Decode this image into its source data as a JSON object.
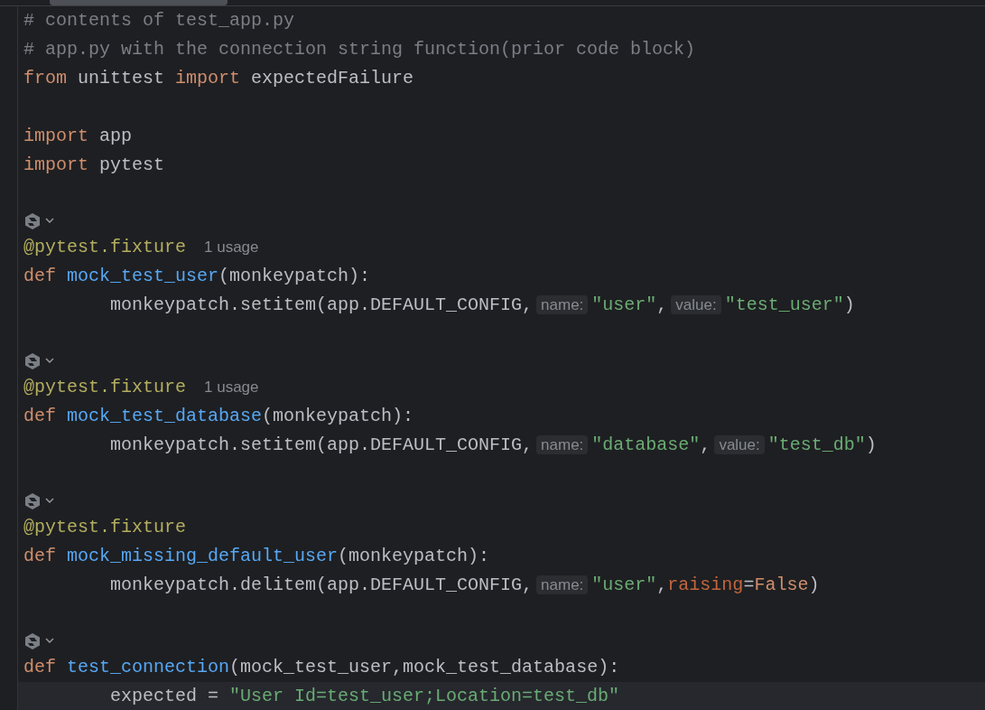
{
  "editor": {
    "lines": [
      {
        "kind": "code",
        "indented": false,
        "current": false,
        "tokens": [
          {
            "kind": "comment",
            "text": "# contents of test_app.py"
          }
        ]
      },
      {
        "kind": "code",
        "indented": false,
        "current": false,
        "tokens": [
          {
            "kind": "comment",
            "text": "# app.py with the connection string function(prior code block)"
          }
        ]
      },
      {
        "kind": "code",
        "indented": false,
        "current": false,
        "tokens": [
          {
            "kind": "kw",
            "text": "from"
          },
          {
            "kind": "plain",
            "text": " unittest"
          },
          {
            "kind": "kw",
            "text": " import"
          },
          {
            "kind": "plain",
            "text": " expectedFailure"
          }
        ]
      },
      {
        "kind": "blank"
      },
      {
        "kind": "code",
        "indented": false,
        "current": false,
        "tokens": [
          {
            "kind": "kw",
            "text": "import"
          },
          {
            "kind": "plain",
            "text": " app"
          }
        ]
      },
      {
        "kind": "code",
        "indented": false,
        "current": false,
        "tokens": [
          {
            "kind": "kw",
            "text": "import"
          },
          {
            "kind": "plain",
            "text": " pytest"
          }
        ]
      },
      {
        "kind": "blank"
      },
      {
        "kind": "fold"
      },
      {
        "kind": "code",
        "indented": false,
        "current": false,
        "tokens": [
          {
            "kind": "deco",
            "text": "@pytest.fixture"
          },
          {
            "kind": "usage",
            "text": "1 usage"
          }
        ]
      },
      {
        "kind": "code",
        "indented": false,
        "current": false,
        "tokens": [
          {
            "kind": "kw",
            "text": "def"
          },
          {
            "kind": "func",
            "text": " mock_test_user"
          },
          {
            "kind": "plain",
            "text": "(monkeypatch):"
          }
        ]
      },
      {
        "kind": "code",
        "indented": true,
        "current": false,
        "tokens": [
          {
            "kind": "plain",
            "text": "monkeypatch.setitem(app.DEFAULT_CONFIG,"
          },
          {
            "kind": "inlay",
            "text": "name:"
          },
          {
            "kind": "str",
            "text": "\"user\""
          },
          {
            "kind": "plain",
            "text": ","
          },
          {
            "kind": "inlay",
            "text": "value:"
          },
          {
            "kind": "str",
            "text": "\"test_user\""
          },
          {
            "kind": "plain",
            "text": ")"
          }
        ]
      },
      {
        "kind": "blank"
      },
      {
        "kind": "fold"
      },
      {
        "kind": "code",
        "indented": false,
        "current": false,
        "tokens": [
          {
            "kind": "deco",
            "text": "@pytest.fixture"
          },
          {
            "kind": "usage",
            "text": "1 usage"
          }
        ]
      },
      {
        "kind": "code",
        "indented": false,
        "current": false,
        "tokens": [
          {
            "kind": "kw",
            "text": "def"
          },
          {
            "kind": "func",
            "text": " mock_test_database"
          },
          {
            "kind": "plain",
            "text": "(monkeypatch):"
          }
        ]
      },
      {
        "kind": "code",
        "indented": true,
        "current": false,
        "tokens": [
          {
            "kind": "plain",
            "text": "monkeypatch.setitem(app.DEFAULT_CONFIG,"
          },
          {
            "kind": "inlay",
            "text": "name:"
          },
          {
            "kind": "str",
            "text": "\"database\""
          },
          {
            "kind": "plain",
            "text": ","
          },
          {
            "kind": "inlay",
            "text": "value:"
          },
          {
            "kind": "str",
            "text": "\"test_db\""
          },
          {
            "kind": "plain",
            "text": ")"
          }
        ]
      },
      {
        "kind": "blank"
      },
      {
        "kind": "fold"
      },
      {
        "kind": "code",
        "indented": false,
        "current": false,
        "tokens": [
          {
            "kind": "deco",
            "text": "@pytest.fixture"
          }
        ]
      },
      {
        "kind": "code",
        "indented": false,
        "current": false,
        "tokens": [
          {
            "kind": "kw",
            "text": "def"
          },
          {
            "kind": "func",
            "text": " mock_missing_default_user"
          },
          {
            "kind": "plain",
            "text": "(monkeypatch):"
          }
        ]
      },
      {
        "kind": "code",
        "indented": true,
        "current": false,
        "tokens": [
          {
            "kind": "plain",
            "text": "monkeypatch.delitem(app.DEFAULT_CONFIG,"
          },
          {
            "kind": "inlay",
            "text": "name:"
          },
          {
            "kind": "str",
            "text": "\"user\""
          },
          {
            "kind": "plain",
            "text": ","
          },
          {
            "kind": "named",
            "text": "raising"
          },
          {
            "kind": "plain",
            "text": "="
          },
          {
            "kind": "kw",
            "text": "False"
          },
          {
            "kind": "plain",
            "text": ")"
          }
        ]
      },
      {
        "kind": "blank"
      },
      {
        "kind": "fold"
      },
      {
        "kind": "code",
        "indented": false,
        "current": false,
        "tokens": [
          {
            "kind": "kw",
            "text": "def"
          },
          {
            "kind": "func",
            "text": " test_connection"
          },
          {
            "kind": "plain",
            "text": "(mock_test_user,mock_test_database):"
          }
        ]
      },
      {
        "kind": "code",
        "indented": true,
        "current": true,
        "tokens": [
          {
            "kind": "plain",
            "text": "expected ="
          },
          {
            "kind": "str",
            "text": " \"User Id=test_user;Location=test_db\""
          }
        ]
      }
    ]
  }
}
